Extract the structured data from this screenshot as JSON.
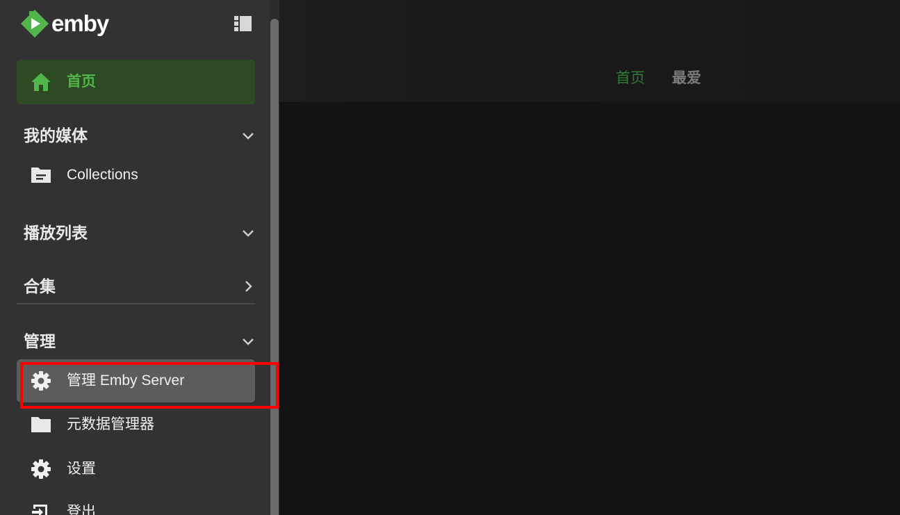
{
  "app": {
    "logo_text": "emby",
    "brand_color": "#52b54b"
  },
  "sidebar": {
    "home": {
      "label": "首页",
      "icon": "home-icon"
    },
    "sections": [
      {
        "label": "我的媒体",
        "chevron": "chevron-down-icon"
      },
      {
        "label": "播放列表",
        "chevron": "chevron-down-icon"
      },
      {
        "label": "合集",
        "chevron": "chevron-right-icon"
      },
      {
        "label": "管理",
        "chevron": "chevron-down-icon"
      }
    ],
    "media_items": [
      {
        "label": "Collections",
        "icon": "folder-icon"
      }
    ],
    "admin_items": [
      {
        "label": "管理 Emby Server",
        "icon": "gear-icon"
      },
      {
        "label": "元数据管理器",
        "icon": "folder-icon"
      },
      {
        "label": "设置",
        "icon": "gear-icon"
      },
      {
        "label": "登出",
        "icon": "logout-icon"
      }
    ]
  },
  "header": {
    "tabs": [
      {
        "label": "首页",
        "active": true
      },
      {
        "label": "最爱",
        "active": false
      }
    ]
  },
  "colors": {
    "highlight": "#ff0000",
    "active_tab": "#2e7d32"
  }
}
